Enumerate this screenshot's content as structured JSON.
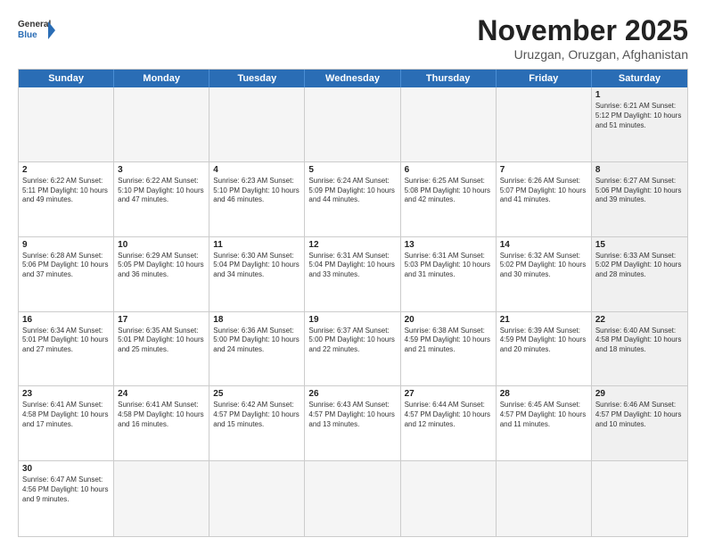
{
  "logo": {
    "text_general": "General",
    "text_blue": "Blue"
  },
  "header": {
    "month": "November 2025",
    "location": "Uruzgan, Oruzgan, Afghanistan"
  },
  "day_headers": [
    "Sunday",
    "Monday",
    "Tuesday",
    "Wednesday",
    "Thursday",
    "Friday",
    "Saturday"
  ],
  "weeks": [
    [
      {
        "num": "",
        "info": "",
        "empty": true
      },
      {
        "num": "",
        "info": "",
        "empty": true
      },
      {
        "num": "",
        "info": "",
        "empty": true
      },
      {
        "num": "",
        "info": "",
        "empty": true
      },
      {
        "num": "",
        "info": "",
        "empty": true
      },
      {
        "num": "",
        "info": "",
        "empty": true
      },
      {
        "num": "1",
        "info": "Sunrise: 6:21 AM\nSunset: 5:12 PM\nDaylight: 10 hours\nand 51 minutes.",
        "saturday": true
      }
    ],
    [
      {
        "num": "2",
        "info": "Sunrise: 6:22 AM\nSunset: 5:11 PM\nDaylight: 10 hours\nand 49 minutes."
      },
      {
        "num": "3",
        "info": "Sunrise: 6:22 AM\nSunset: 5:10 PM\nDaylight: 10 hours\nand 47 minutes."
      },
      {
        "num": "4",
        "info": "Sunrise: 6:23 AM\nSunset: 5:10 PM\nDaylight: 10 hours\nand 46 minutes."
      },
      {
        "num": "5",
        "info": "Sunrise: 6:24 AM\nSunset: 5:09 PM\nDaylight: 10 hours\nand 44 minutes."
      },
      {
        "num": "6",
        "info": "Sunrise: 6:25 AM\nSunset: 5:08 PM\nDaylight: 10 hours\nand 42 minutes."
      },
      {
        "num": "7",
        "info": "Sunrise: 6:26 AM\nSunset: 5:07 PM\nDaylight: 10 hours\nand 41 minutes."
      },
      {
        "num": "8",
        "info": "Sunrise: 6:27 AM\nSunset: 5:06 PM\nDaylight: 10 hours\nand 39 minutes.",
        "saturday": true
      }
    ],
    [
      {
        "num": "9",
        "info": "Sunrise: 6:28 AM\nSunset: 5:06 PM\nDaylight: 10 hours\nand 37 minutes."
      },
      {
        "num": "10",
        "info": "Sunrise: 6:29 AM\nSunset: 5:05 PM\nDaylight: 10 hours\nand 36 minutes."
      },
      {
        "num": "11",
        "info": "Sunrise: 6:30 AM\nSunset: 5:04 PM\nDaylight: 10 hours\nand 34 minutes."
      },
      {
        "num": "12",
        "info": "Sunrise: 6:31 AM\nSunset: 5:04 PM\nDaylight: 10 hours\nand 33 minutes."
      },
      {
        "num": "13",
        "info": "Sunrise: 6:31 AM\nSunset: 5:03 PM\nDaylight: 10 hours\nand 31 minutes."
      },
      {
        "num": "14",
        "info": "Sunrise: 6:32 AM\nSunset: 5:02 PM\nDaylight: 10 hours\nand 30 minutes."
      },
      {
        "num": "15",
        "info": "Sunrise: 6:33 AM\nSunset: 5:02 PM\nDaylight: 10 hours\nand 28 minutes.",
        "saturday": true
      }
    ],
    [
      {
        "num": "16",
        "info": "Sunrise: 6:34 AM\nSunset: 5:01 PM\nDaylight: 10 hours\nand 27 minutes."
      },
      {
        "num": "17",
        "info": "Sunrise: 6:35 AM\nSunset: 5:01 PM\nDaylight: 10 hours\nand 25 minutes."
      },
      {
        "num": "18",
        "info": "Sunrise: 6:36 AM\nSunset: 5:00 PM\nDaylight: 10 hours\nand 24 minutes."
      },
      {
        "num": "19",
        "info": "Sunrise: 6:37 AM\nSunset: 5:00 PM\nDaylight: 10 hours\nand 22 minutes."
      },
      {
        "num": "20",
        "info": "Sunrise: 6:38 AM\nSunset: 4:59 PM\nDaylight: 10 hours\nand 21 minutes."
      },
      {
        "num": "21",
        "info": "Sunrise: 6:39 AM\nSunset: 4:59 PM\nDaylight: 10 hours\nand 20 minutes."
      },
      {
        "num": "22",
        "info": "Sunrise: 6:40 AM\nSunset: 4:58 PM\nDaylight: 10 hours\nand 18 minutes.",
        "saturday": true
      }
    ],
    [
      {
        "num": "23",
        "info": "Sunrise: 6:41 AM\nSunset: 4:58 PM\nDaylight: 10 hours\nand 17 minutes."
      },
      {
        "num": "24",
        "info": "Sunrise: 6:41 AM\nSunset: 4:58 PM\nDaylight: 10 hours\nand 16 minutes."
      },
      {
        "num": "25",
        "info": "Sunrise: 6:42 AM\nSunset: 4:57 PM\nDaylight: 10 hours\nand 15 minutes."
      },
      {
        "num": "26",
        "info": "Sunrise: 6:43 AM\nSunset: 4:57 PM\nDaylight: 10 hours\nand 13 minutes."
      },
      {
        "num": "27",
        "info": "Sunrise: 6:44 AM\nSunset: 4:57 PM\nDaylight: 10 hours\nand 12 minutes."
      },
      {
        "num": "28",
        "info": "Sunrise: 6:45 AM\nSunset: 4:57 PM\nDaylight: 10 hours\nand 11 minutes."
      },
      {
        "num": "29",
        "info": "Sunrise: 6:46 AM\nSunset: 4:57 PM\nDaylight: 10 hours\nand 10 minutes.",
        "saturday": true
      }
    ],
    [
      {
        "num": "30",
        "info": "Sunrise: 6:47 AM\nSunset: 4:56 PM\nDaylight: 10 hours\nand 9 minutes."
      },
      {
        "num": "",
        "info": "",
        "empty": true
      },
      {
        "num": "",
        "info": "",
        "empty": true
      },
      {
        "num": "",
        "info": "",
        "empty": true
      },
      {
        "num": "",
        "info": "",
        "empty": true
      },
      {
        "num": "",
        "info": "",
        "empty": true
      },
      {
        "num": "",
        "info": "",
        "empty": true,
        "saturday": true
      }
    ]
  ]
}
